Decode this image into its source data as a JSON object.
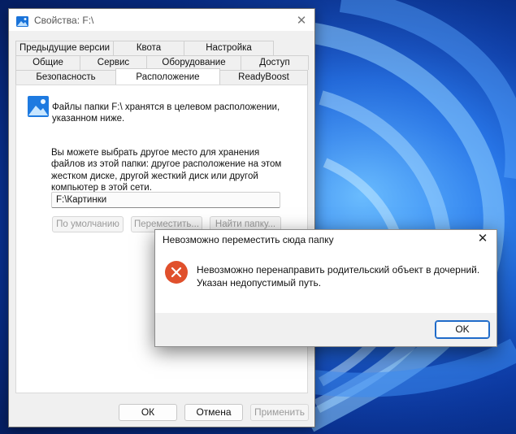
{
  "properties_window": {
    "title": "Свойства: F:\\",
    "close_glyph": "✕",
    "tabs_row1": [
      "Предыдущие версии",
      "Квота",
      "Настройка"
    ],
    "tabs_row2": [
      "Общие",
      "Сервис",
      "Оборудование",
      "Доступ"
    ],
    "tabs_row3": [
      "Безопасность",
      "Расположение",
      "ReadyBoost"
    ],
    "active_tab": "Расположение",
    "panel": {
      "icon": "pictures-folder-icon",
      "line1": "Файлы папки F:\\ хранятся в целевом расположении, указанном ниже.",
      "line2": "Вы можете выбрать другое место для хранения файлов из этой папки: другое расположение на этом жестком диске, другой жесткий диск или другой компьютер в этой сети.",
      "path_value": "F:\\Картинки",
      "btn_default": "По умолчанию",
      "btn_move": "Переместить...",
      "btn_find": "Найти папку..."
    },
    "buttons": {
      "ok": "ОК",
      "cancel": "Отмена",
      "apply": "Применить"
    }
  },
  "error_dialog": {
    "title": "Невозможно переместить сюда папку",
    "close_glyph": "✕",
    "icon": "error-icon",
    "message": "Невозможно перенаправить родительский объект в дочерний. Указан недопустимый путь.",
    "ok": "OK",
    "colors": {
      "error_icon": "#e0502c",
      "accent": "#1f6bc9"
    }
  },
  "desktop": {
    "wallpaper": "windows-11-bloom-blue"
  }
}
